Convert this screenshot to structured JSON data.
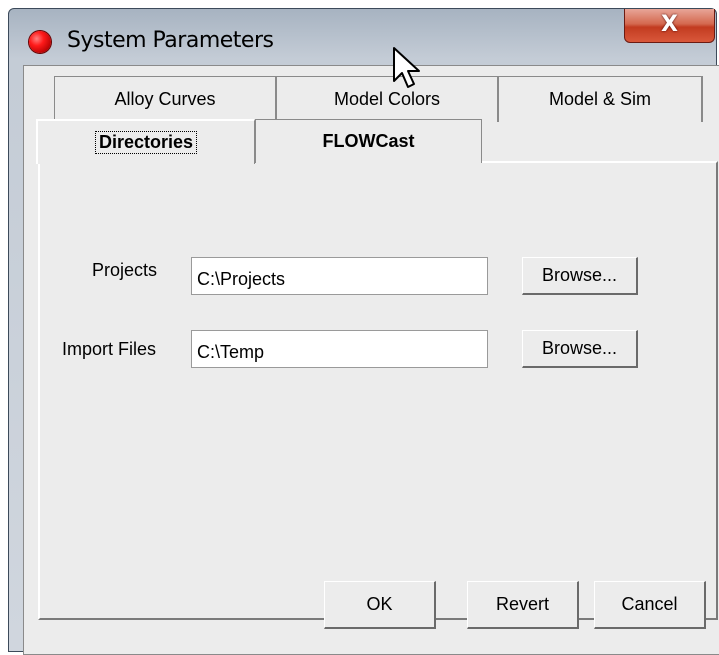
{
  "window": {
    "title": "System Parameters",
    "close_label": "X"
  },
  "tabs": {
    "row1": [
      {
        "label": "Alloy Curves"
      },
      {
        "label": "Model Colors"
      },
      {
        "label": "Model & Sim"
      }
    ],
    "row2": [
      {
        "label": "Directories",
        "selected": true
      },
      {
        "label": "FLOWCast"
      }
    ]
  },
  "directories": {
    "projects_label": "Projects",
    "projects_value": "C:\\Projects",
    "projects_browse": "Browse...",
    "import_label": "Import Files",
    "import_value": "C:\\Temp",
    "import_browse": "Browse..."
  },
  "footer": {
    "ok": "OK",
    "revert": "Revert",
    "cancel": "Cancel"
  },
  "colors": {
    "dialog_bg": "#ececec",
    "close_button": "#c23b20",
    "app_icon": "#ff1a1a"
  },
  "icons": [
    "app-red-dot-icon",
    "close-icon",
    "mouse-cursor-icon"
  ]
}
